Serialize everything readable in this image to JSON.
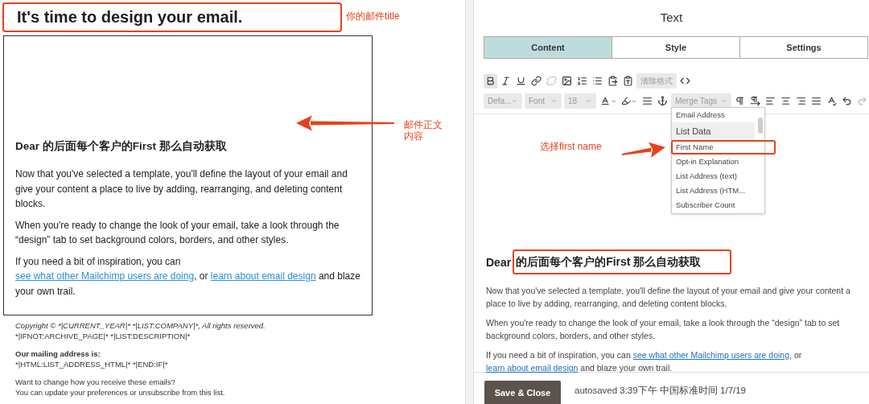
{
  "preview": {
    "email_title": "It's time to design your email.",
    "title_note": "你的邮件title",
    "body_note": "邮件正文内容",
    "heading": "Dear 的后面每个客户的First 那么自动获取",
    "paragraphs": [
      [
        {
          "kind": "text",
          "text": "Now that you've selected a template, you'll define the layout of your email and give your content a place to live by adding, rearranging, and deleting content blocks."
        }
      ],
      [
        {
          "kind": "text",
          "text": "When you're ready to change the look of your email, take a look through the “design” tab to set background colors, borders, and other styles."
        }
      ],
      [
        {
          "kind": "text",
          "text": "If you need a bit of inspiration, you can "
        },
        {
          "kind": "link",
          "text": "see what other Mailchimp users are doing"
        },
        {
          "kind": "text",
          "text": ", or "
        },
        {
          "kind": "link",
          "text": "learn about email design"
        },
        {
          "kind": "text",
          "text": " and blaze your own trail."
        }
      ]
    ],
    "footer": [
      [
        {
          "kind": "italic",
          "text": "Copyright © *|CURRENT_YEAR|* *|LIST:COMPANY|*, All rights reserved."
        },
        {
          "kind": "plain",
          "text": "*|IFNOT:ARCHIVE_PAGE|* *|LIST:DESCRIPTION|*"
        }
      ],
      [
        {
          "kind": "bold",
          "text": "Our mailing address is:"
        },
        {
          "kind": "plain",
          "text": "*|HTML:LIST_ADDRESS_HTML|* *|END:IF|*"
        }
      ],
      [
        {
          "kind": "plain",
          "text": "Want to change how you receive these emails?"
        },
        {
          "kind": "plain",
          "text": "You can update your preferences or unsubscribe from this list."
        }
      ]
    ]
  },
  "editor": {
    "title": "Text",
    "tabs": [
      {
        "label": "Content",
        "selected": true
      },
      {
        "label": "Style",
        "selected": false
      },
      {
        "label": "Settings",
        "selected": false
      }
    ],
    "toolbar": {
      "bold": {
        "active": true
      },
      "unlink": {
        "disabled": true
      },
      "redo": {
        "disabled": true
      },
      "clear_format": "清除格式",
      "style_select": "Defa...",
      "font_select": "Font",
      "size_select": "18",
      "merge_tags": "Merge Tags"
    },
    "merge_menu": [
      {
        "kind": "item",
        "label": "Email Address",
        "annotated": false
      },
      {
        "kind": "header",
        "label": "List Data",
        "annotated": false
      },
      {
        "kind": "item",
        "label": "First Name",
        "annotated": true
      },
      {
        "kind": "item",
        "label": "Opt-in Explanation",
        "annotated": false
      },
      {
        "kind": "item",
        "label": "List Address (text)",
        "annotated": false
      },
      {
        "kind": "item",
        "label": "List Address (HTM...",
        "annotated": false
      },
      {
        "kind": "item",
        "label": "Subscriber Count",
        "annotated": false
      }
    ],
    "menu_note": "选择first name",
    "heading_lead": "Dear",
    "heading_boxed": "的后面每个客户的First 那么自动获取",
    "paragraphs": [
      [
        {
          "kind": "text",
          "text": "Now that you've selected a template, you'll define the layout of your email and give your content a place to live by adding, rearranging, and deleting content blocks."
        }
      ],
      [
        {
          "kind": "text",
          "text": "When you're ready to change the look of your email, take a look through the “design” tab to set background colors, borders, and other styles."
        }
      ],
      [
        {
          "kind": "text",
          "text": "If you need a bit of inspiration, you can "
        },
        {
          "kind": "link",
          "text": "see what other Mailchimp users are doing"
        },
        {
          "kind": "text",
          "text": ", or "
        },
        {
          "kind": "link",
          "text": "learn about email design"
        },
        {
          "kind": "text",
          "text": " and blaze your own trail."
        }
      ]
    ],
    "save_button": "Save & Close",
    "autosave": "autosaved 3:39下午 中国标准时间 1/7/19"
  }
}
